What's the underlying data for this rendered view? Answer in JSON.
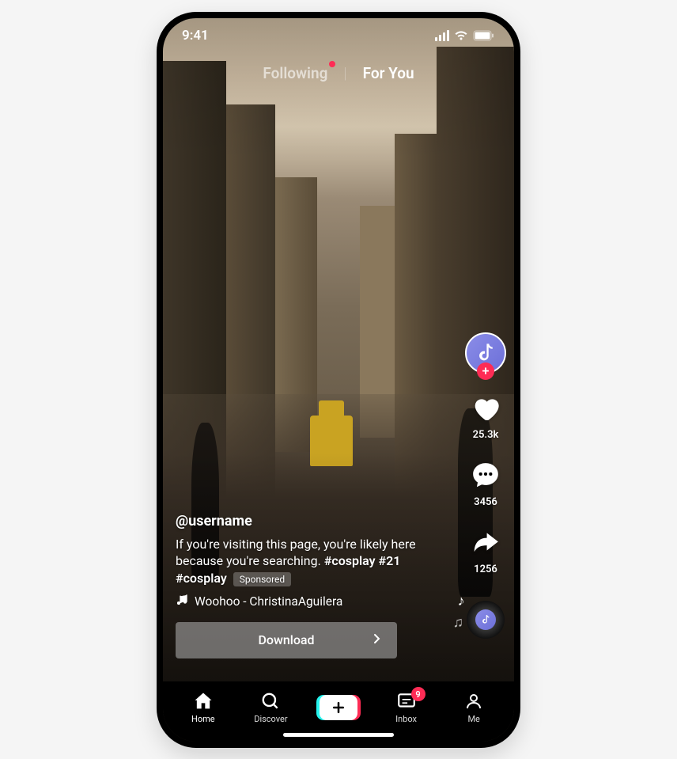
{
  "statusBar": {
    "time": "9:41"
  },
  "tabs": {
    "following": "Following",
    "foryou": "For You"
  },
  "rightRail": {
    "likes": "25.3k",
    "comments": "3456",
    "shares": "1256"
  },
  "content": {
    "username": "@username",
    "caption_prefix": "If you're visiting this page, you're likely here because you're searching. ",
    "hashtag1": "#cosplay",
    "hashtag2": "#21",
    "hashtag3": "#cosplay",
    "sponsored": "Sponsored",
    "music": "Woohoo - ChristinaAguilera",
    "cta": "Download"
  },
  "bottomNav": {
    "home": "Home",
    "discover": "Discover",
    "inbox": "Inbox",
    "inbox_badge": "9",
    "me": "Me"
  }
}
